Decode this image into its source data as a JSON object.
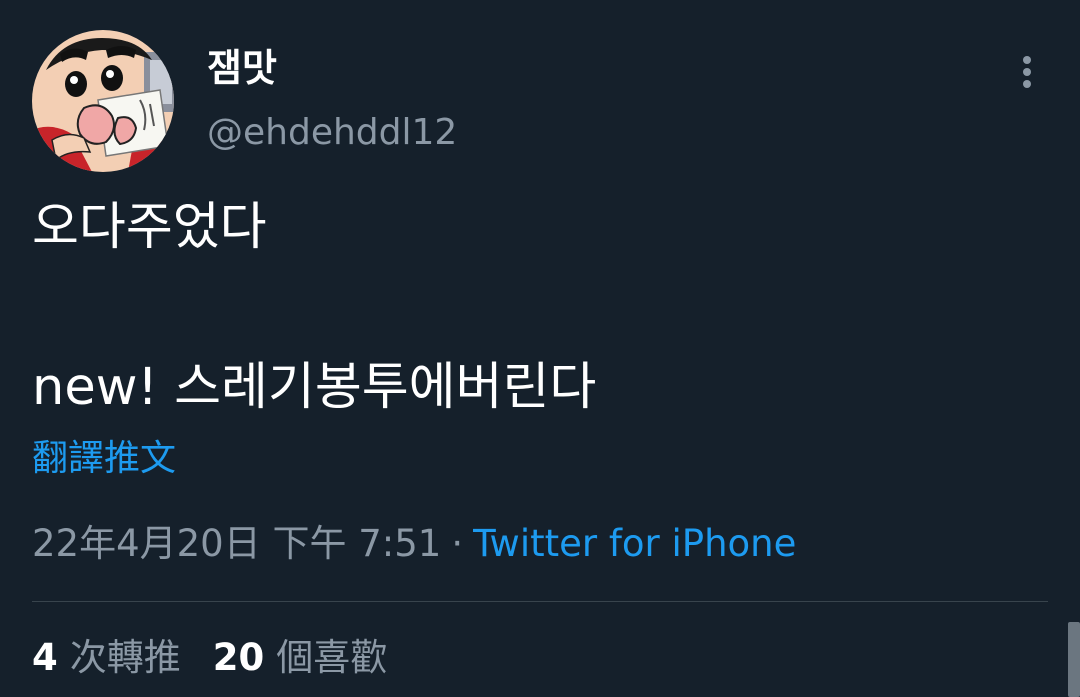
{
  "author": {
    "display_name": "잼맛",
    "handle": "@ehdehddl12",
    "avatar_icon": "cartoon-boy-avatar-icon"
  },
  "menu": {
    "icon": "more-vertical-icon"
  },
  "tweet": {
    "text": "오다주었다\n\nnew! 스레기봉투에버린다",
    "translate_label": "翻譯推文",
    "date": "22年4月20日 下午 7:51",
    "separator": "·",
    "source": "Twitter for iPhone"
  },
  "stats": {
    "retweets": {
      "count": "4",
      "label": "次轉推"
    },
    "likes": {
      "count": "20",
      "label": "個喜歡"
    }
  },
  "colors": {
    "background": "#15202b",
    "text_primary": "#ffffff",
    "text_secondary": "#8b98a5",
    "accent": "#1d9bf0",
    "divider": "#38444d"
  }
}
